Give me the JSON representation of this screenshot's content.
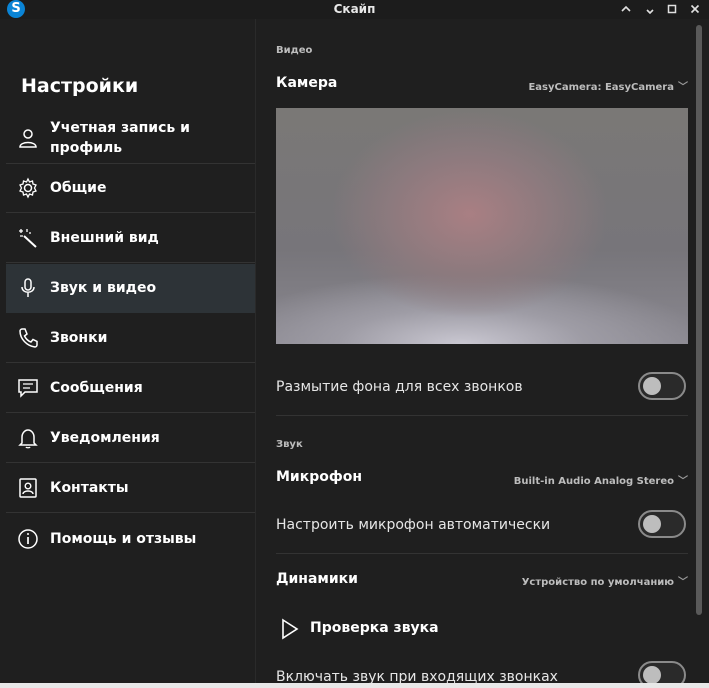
{
  "window": {
    "title": "Скайп",
    "app_icon": "S",
    "controls": {
      "minimize": "⌃",
      "restore": "▫",
      "maximize": "☐",
      "close": "✕"
    }
  },
  "sidebar": {
    "title": "Настройки",
    "items": [
      {
        "label": "Учетная запись и профиль",
        "icon": "person-icon"
      },
      {
        "label": "Общие",
        "icon": "gear-icon"
      },
      {
        "label": "Внешний вид",
        "icon": "magic-wand-icon"
      },
      {
        "label": "Звук и видео",
        "icon": "microphone-icon",
        "active": true
      },
      {
        "label": "Звонки",
        "icon": "phone-icon"
      },
      {
        "label": "Сообщения",
        "icon": "message-icon"
      },
      {
        "label": "Уведомления",
        "icon": "bell-icon"
      },
      {
        "label": "Контакты",
        "icon": "contacts-icon"
      },
      {
        "label": "Помощь и отзывы",
        "icon": "info-icon"
      }
    ]
  },
  "main": {
    "video_section": "Видео",
    "camera_label": "Камера",
    "camera_value": "EasyCamera: EasyCamera",
    "blur_label": "Размытие фона для всех звонков",
    "blur_on": false,
    "sound_section": "Звук",
    "mic_label": "Микрофон",
    "mic_value": "Built-in Audio Analog Stereo",
    "auto_mic_label": "Настроить микрофон автоматически",
    "auto_mic_on": false,
    "speakers_label": "Динамики",
    "speakers_value": "Устройство по умолчанию",
    "test_sound_label": "Проверка звука",
    "incoming_label": "Включать звук при входящих звонках",
    "incoming_on": false
  },
  "colors": {
    "background": "#1f1f1f",
    "active_item": "#2d3337",
    "skype_blue": "#0a84d6"
  }
}
